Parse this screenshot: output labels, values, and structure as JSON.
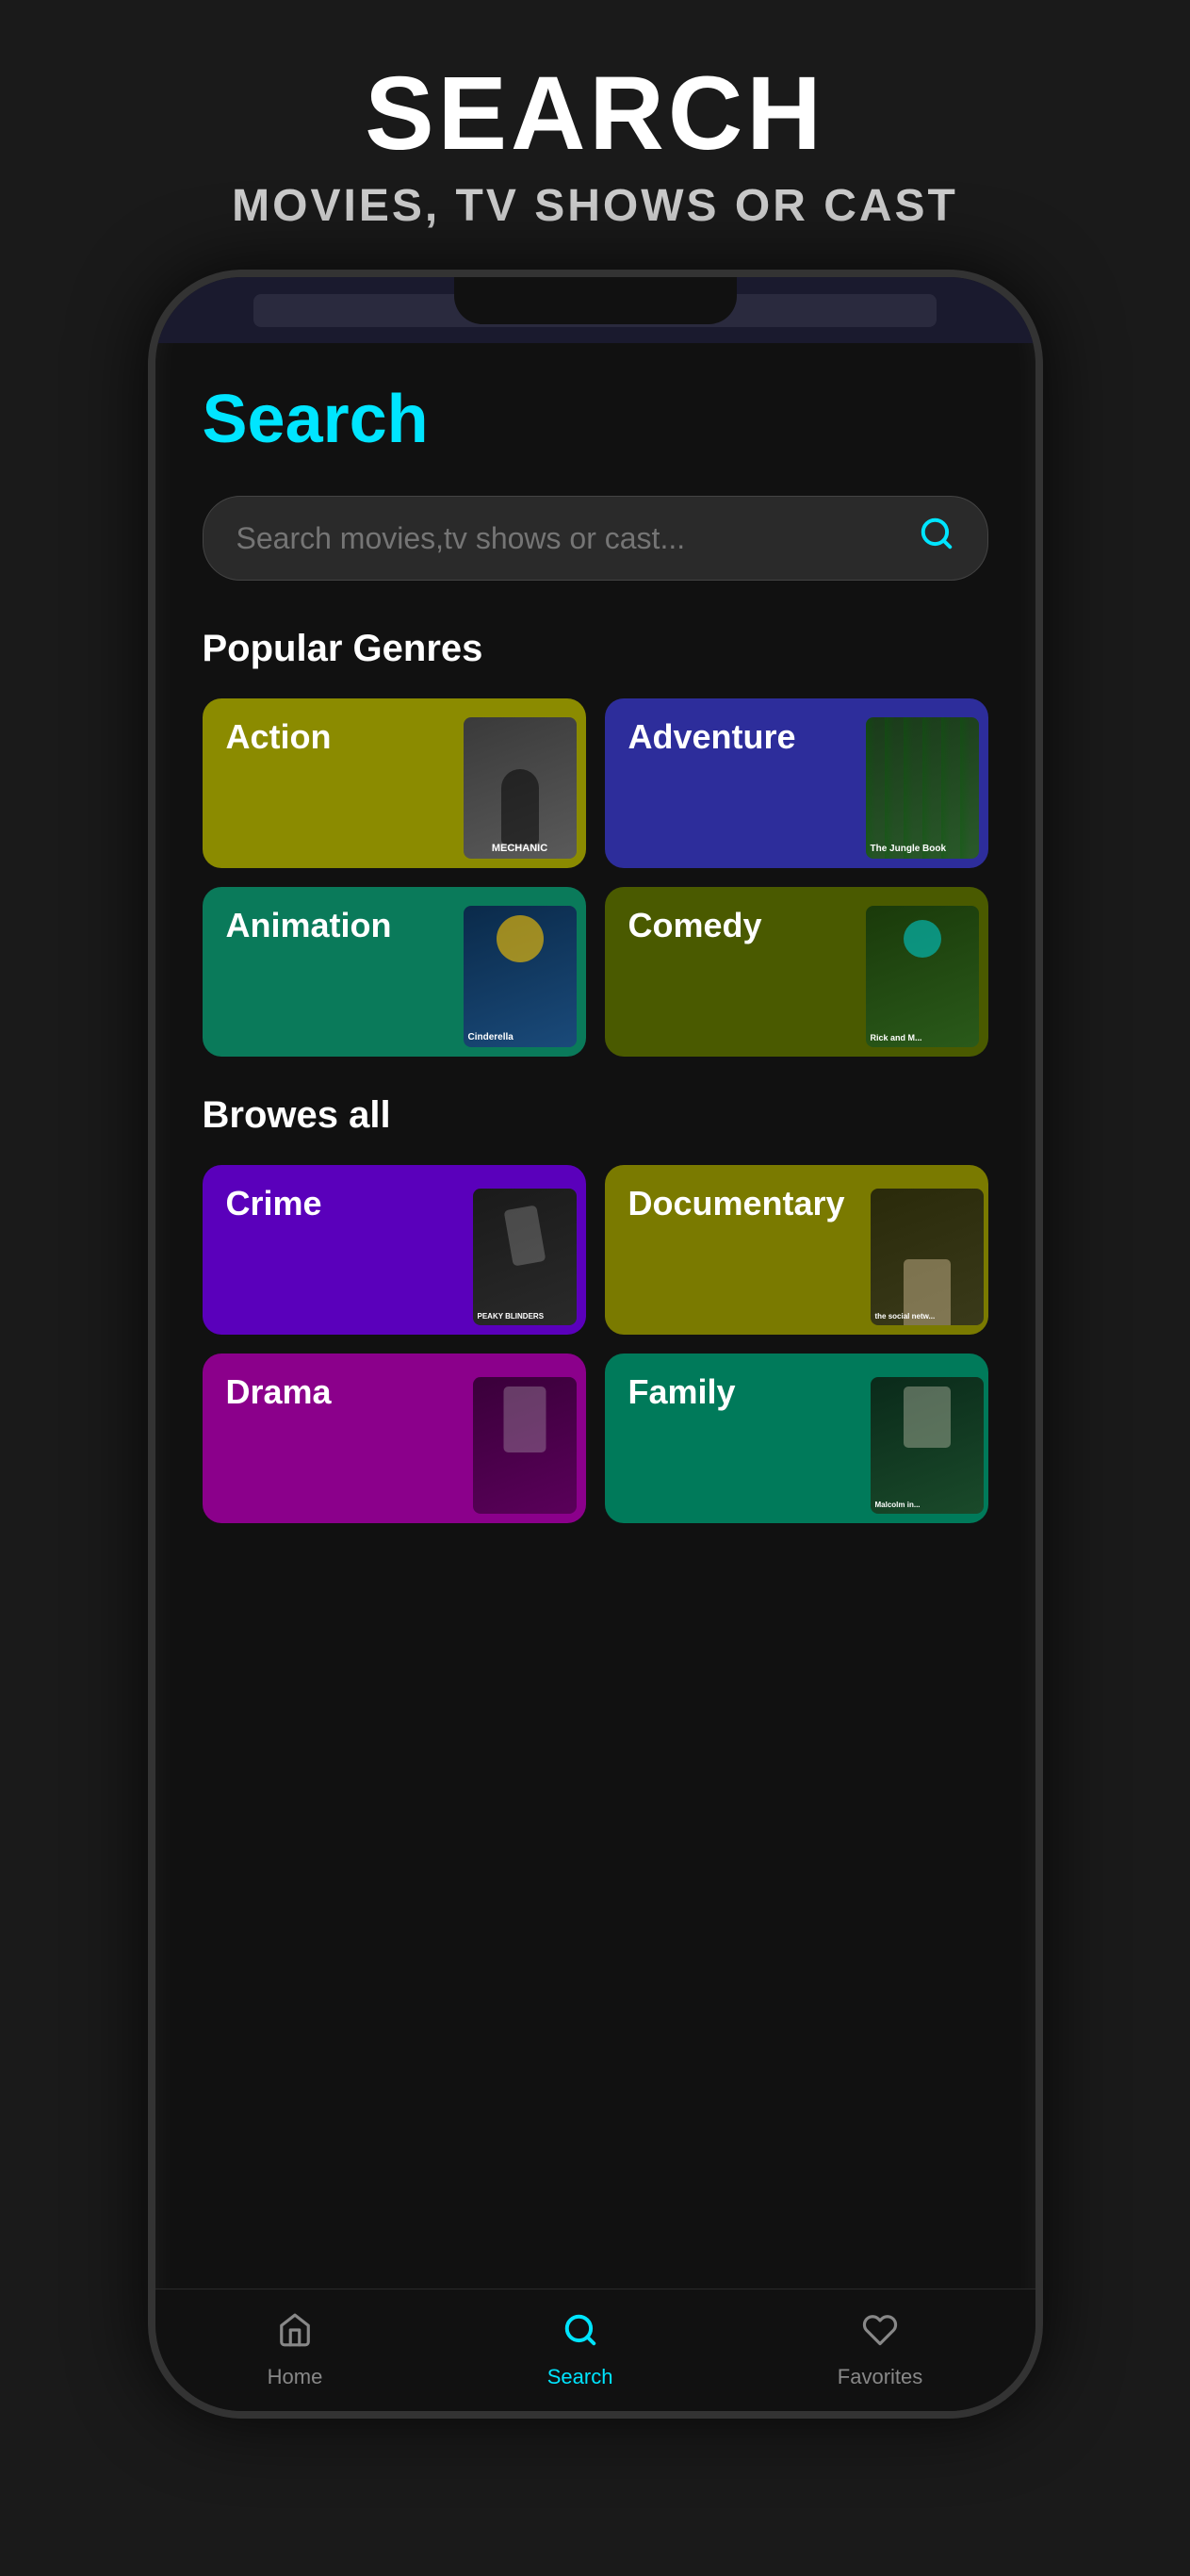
{
  "app": {
    "background_color": "#1a1a1a"
  },
  "top_section": {
    "title": "SEARCH",
    "subtitle": "MOVIES, TV SHOWS OR CAST"
  },
  "search_page": {
    "heading": "Search",
    "search_placeholder": "Search movies,tv shows or cast...",
    "popular_genres_label": "Popular Genres",
    "browses_all_label": "Browes all",
    "genres_popular": [
      {
        "name": "Action",
        "color": "#8B8B00",
        "poster": "mechanic"
      },
      {
        "name": "Adventure",
        "color": "#2D2D9B",
        "poster": "jungle-book"
      },
      {
        "name": "Animation",
        "color": "#0A7A5A",
        "poster": "cinderella"
      },
      {
        "name": "Comedy",
        "color": "#4A5A00",
        "poster": "rick-morty"
      }
    ],
    "genres_all": [
      {
        "name": "Crime",
        "color": "#5A00BB",
        "poster": "peaky"
      },
      {
        "name": "Documentary",
        "color": "#7A7A00",
        "poster": "social-network"
      },
      {
        "name": "Drama",
        "color": "#8B008B",
        "poster": "drama"
      },
      {
        "name": "Family",
        "color": "#007A5A",
        "poster": "family"
      }
    ]
  },
  "bottom_nav": {
    "items": [
      {
        "label": "Home",
        "icon": "home",
        "active": false
      },
      {
        "label": "Search",
        "icon": "search",
        "active": true
      },
      {
        "label": "Favorites",
        "icon": "heart",
        "active": false
      }
    ]
  }
}
